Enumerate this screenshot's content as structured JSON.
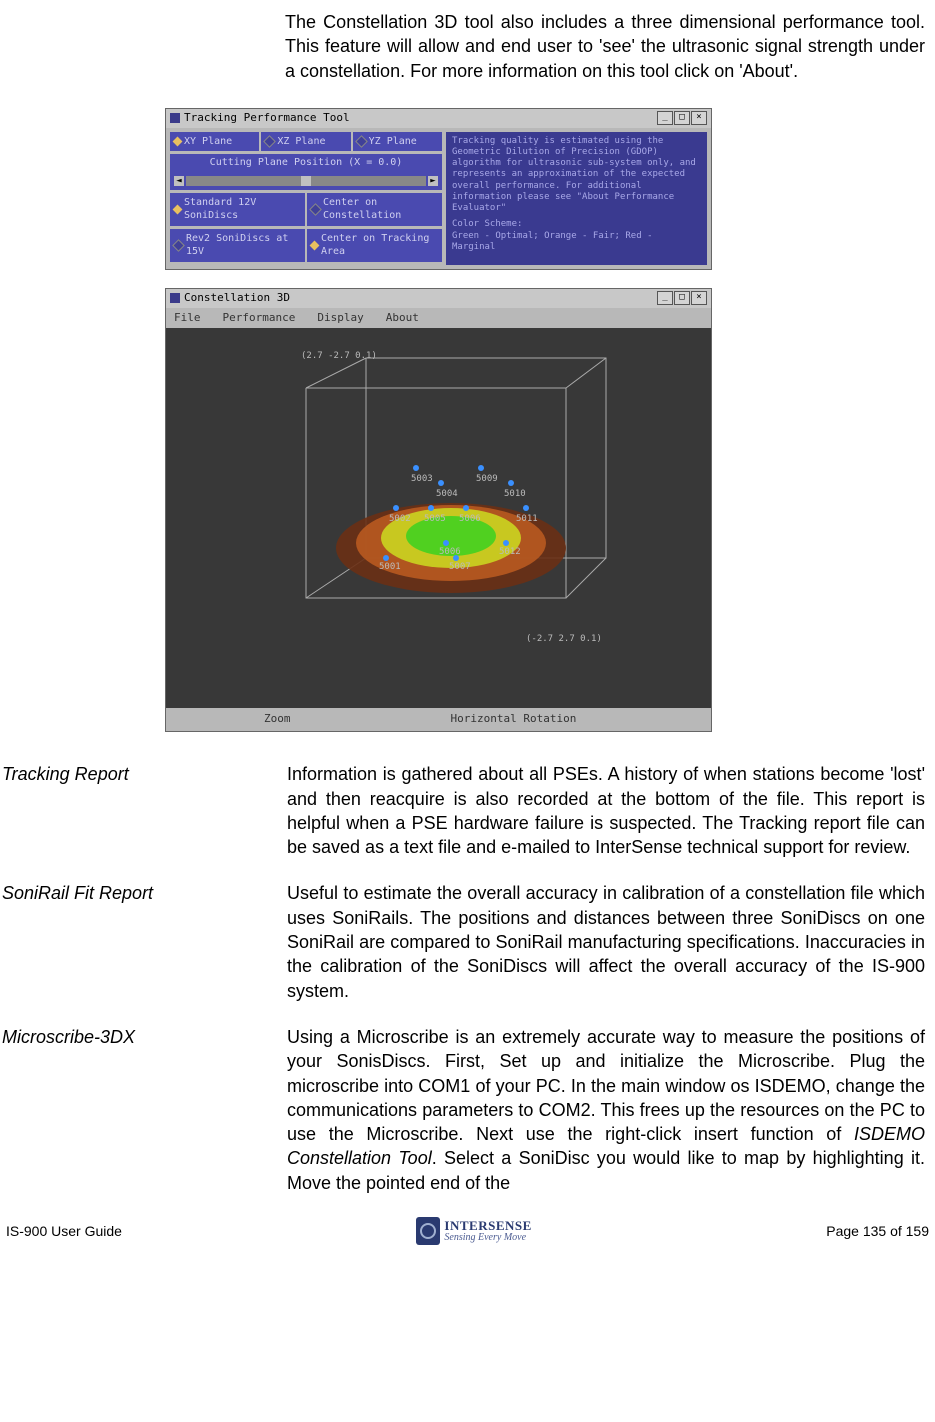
{
  "intro": "The Constellation 3D tool also includes a three dimensional performance tool.  This feature will allow and end user to 'see' the ultrasonic signal strength under a constellation.  For more information on this tool click on 'About'.",
  "tool1": {
    "title": "Tracking Performance Tool",
    "radios1": [
      "XY Plane",
      "XZ Plane",
      "YZ Plane"
    ],
    "slider_label": "Cutting Plane Position (X = 0.0)",
    "radios2": [
      "Standard 12V SoniDiscs",
      "Center on Constellation",
      "Rev2 SoniDiscs at 15V",
      "Center on Tracking Area"
    ],
    "right_text": "Tracking quality is estimated using the Geometric Dilution of Precision (GDOP) algorithm for ultrasonic sub-system only, and represents an approximation of the expected overall performance. For additional information please see \"About Performance Evaluator\"",
    "right_scheme_label": "Color Scheme:",
    "right_scheme": "Green - Optimal; Orange - Fair; Red - Marginal"
  },
  "tool2": {
    "title": "Constellation 3D",
    "menus": [
      "File",
      "Performance",
      "Display",
      "About"
    ],
    "coord_top": "(2.7 -2.7 0.1)",
    "coord_bot": "(-2.7 2.7 0.1)",
    "sensors": [
      "5003",
      "5009",
      "5004",
      "5010",
      "5002",
      "5005",
      "5006",
      "5011",
      "5006",
      "5012",
      "5001",
      "5007"
    ],
    "zoom_label": "Zoom",
    "rotate_label": "Horizontal Rotation"
  },
  "defs": [
    {
      "term": "Tracking Report",
      "body": "Information is gathered about all PSEs.  A history of when stations become 'lost' and then reacquire is also recorded at the bottom of the file.  This report is helpful when a PSE hardware failure is suspected.  The Tracking report file can be saved as a text file and e-mailed to InterSense technical support for review."
    },
    {
      "term": "SoniRail Fit Report",
      "body": "Useful to estimate the overall accuracy in calibration of a constellation file which uses SoniRails.  The positions and distances between three SoniDiscs on one SoniRail are compared to SoniRail manufacturing specifications.  Inaccuracies in the calibration of the SoniDiscs will affect the overall accuracy of the IS-900 system."
    },
    {
      "term": "Microscribe-3DX",
      "body_prefix": "Using a Microscribe is an extremely accurate way to measure the positions of your SonisDiscs.  First, Set up and initialize the Microscribe.  Plug the microscribe into COM1 of your PC.  In the main window os ISDEMO, change the communications parameters to COM2.  This frees up the resources on the PC to use the Microscribe.  Next use the right-click insert function of ",
      "body_italic": "ISDEMO Constellation Tool",
      "body_suffix": ".  Select a SoniDisc you would like to map by highlighting it.  Move the pointed end of the"
    }
  ],
  "footer": {
    "left": "IS-900 User Guide",
    "right": "Page 135 of 159",
    "logo_line1": "INTERSENSE",
    "logo_line2": "Sensing Every Move"
  }
}
